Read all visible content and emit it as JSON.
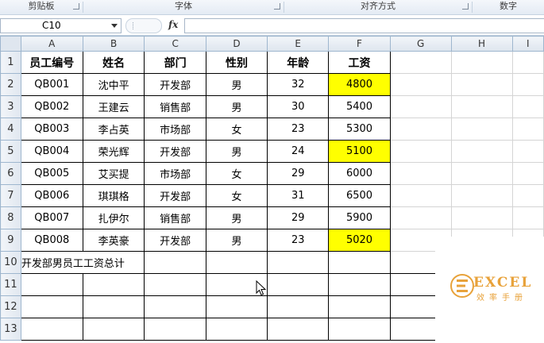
{
  "ribbon": {
    "groups": [
      "剪贴板",
      "字体",
      "对齐方式",
      "数字"
    ]
  },
  "formula_bar": {
    "name_box": "C10",
    "fx_label": "fx",
    "formula": ""
  },
  "columns": [
    "A",
    "B",
    "C",
    "D",
    "E",
    "F",
    "G",
    "H",
    "I"
  ],
  "rows": [
    "1",
    "2",
    "3",
    "4",
    "5",
    "6",
    "7",
    "8",
    "9",
    "10",
    "11",
    "12",
    "13"
  ],
  "table": {
    "headers": [
      "员工编号",
      "姓名",
      "部门",
      "性别",
      "年龄",
      "工资"
    ],
    "records": [
      [
        "QB001",
        "沈中平",
        "开发部",
        "男",
        "32",
        "4800"
      ],
      [
        "QB002",
        "王建云",
        "销售部",
        "男",
        "30",
        "5400"
      ],
      [
        "QB003",
        "李占英",
        "市场部",
        "女",
        "23",
        "5300"
      ],
      [
        "QB004",
        "荣光辉",
        "开发部",
        "男",
        "24",
        "5100"
      ],
      [
        "QB005",
        "艾买提",
        "市场部",
        "女",
        "29",
        "6000"
      ],
      [
        "QB006",
        "琪琪格",
        "开发部",
        "女",
        "31",
        "6500"
      ],
      [
        "QB007",
        "扎伊尔",
        "销售部",
        "男",
        "29",
        "5900"
      ],
      [
        "QB008",
        "李英豪",
        "开发部",
        "男",
        "23",
        "5020"
      ]
    ],
    "summary_label": "开发部男员工工资总计"
  },
  "colors": {
    "highlight": "#ffff00",
    "watermark": "#e8a23a"
  },
  "watermark": {
    "brand": "EXCEL",
    "subtitle": "效率手册"
  }
}
